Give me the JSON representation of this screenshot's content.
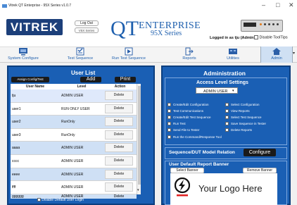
{
  "window": {
    "title": "Vitrek QT Enterprise - 95X Series v1.0.7",
    "minimize_glyph": "–",
    "maximize_glyph": "□",
    "close_glyph": "✕"
  },
  "header": {
    "logo_text": "VITREK",
    "logout_label": "Log Out",
    "series_label": "V5X Series",
    "brand_q": "QT",
    "brand_enterprise": "ENTERPRISE",
    "brand_series": "95X Series",
    "logged_in_text": "Logged in as tju (Admin)",
    "disable_tooltips_label": "Disable ToolTips"
  },
  "tabs": [
    {
      "label": "System Configure",
      "icon": "system-configure-icon"
    },
    {
      "label": "Test Sequence",
      "icon": "test-sequence-icon"
    },
    {
      "label": "Run Test Sequence",
      "icon": "run-test-sequence-icon"
    },
    {
      "label": "Reports",
      "icon": "reports-icon"
    },
    {
      "label": "Utilities",
      "icon": "utilities-icon"
    },
    {
      "label": "Admin",
      "icon": "home-icon",
      "active": true
    }
  ],
  "user_list": {
    "title": "User List",
    "assign_label": "Assign Config/Test Sequence",
    "add_label": "Add",
    "print_label": "Print",
    "columns": [
      "User Name",
      "Level",
      "Action"
    ],
    "rows": [
      {
        "name": "tju",
        "level": "ADMIN USER",
        "action": "Delete"
      },
      {
        "name": "user1",
        "level": "RUN ONLY USER",
        "action": "Delete"
      },
      {
        "name": "user2",
        "level": "RunOnly",
        "action": "Delete"
      },
      {
        "name": "user3",
        "level": "RunOnly",
        "action": "Delete"
      },
      {
        "name": "aaaa",
        "level": "ADMIN USER",
        "action": "Delete"
      },
      {
        "name": "cccc",
        "level": "ADMIN USER",
        "action": "Delete"
      },
      {
        "name": "eeee",
        "level": "ADMIN USER",
        "action": "Delete"
      },
      {
        "name": "ffff",
        "level": "ADMIN USER",
        "action": "Delete"
      },
      {
        "name": "gggggg",
        "level": "ADMIN USER",
        "action": "Delete"
      }
    ],
    "disable_default_login_label": "Disable Default User Login"
  },
  "administration": {
    "title": "Administration",
    "access_title": "Access Level Settings",
    "selected_level": "ADMIN USER",
    "permissions": [
      "Create/Edit Configuration",
      "Select Configuration",
      "Test Communications",
      "View Reports",
      "Create/Edit Test Sequence",
      "Select Test Sequence",
      "Run Test",
      "Save Sequence in Tester",
      "Send File to Tester",
      "Delete Reports",
      "Run the Command/Response Tool"
    ],
    "sequence_relation_label": "Sequence/DUT Model Relation",
    "configure_label": "Configure",
    "banner_title": "User Default Report Banner",
    "select_banner_label": "Select Banner",
    "remove_banner_label": "Remove Banner",
    "banner_logo_text": "Your Logo Here"
  }
}
